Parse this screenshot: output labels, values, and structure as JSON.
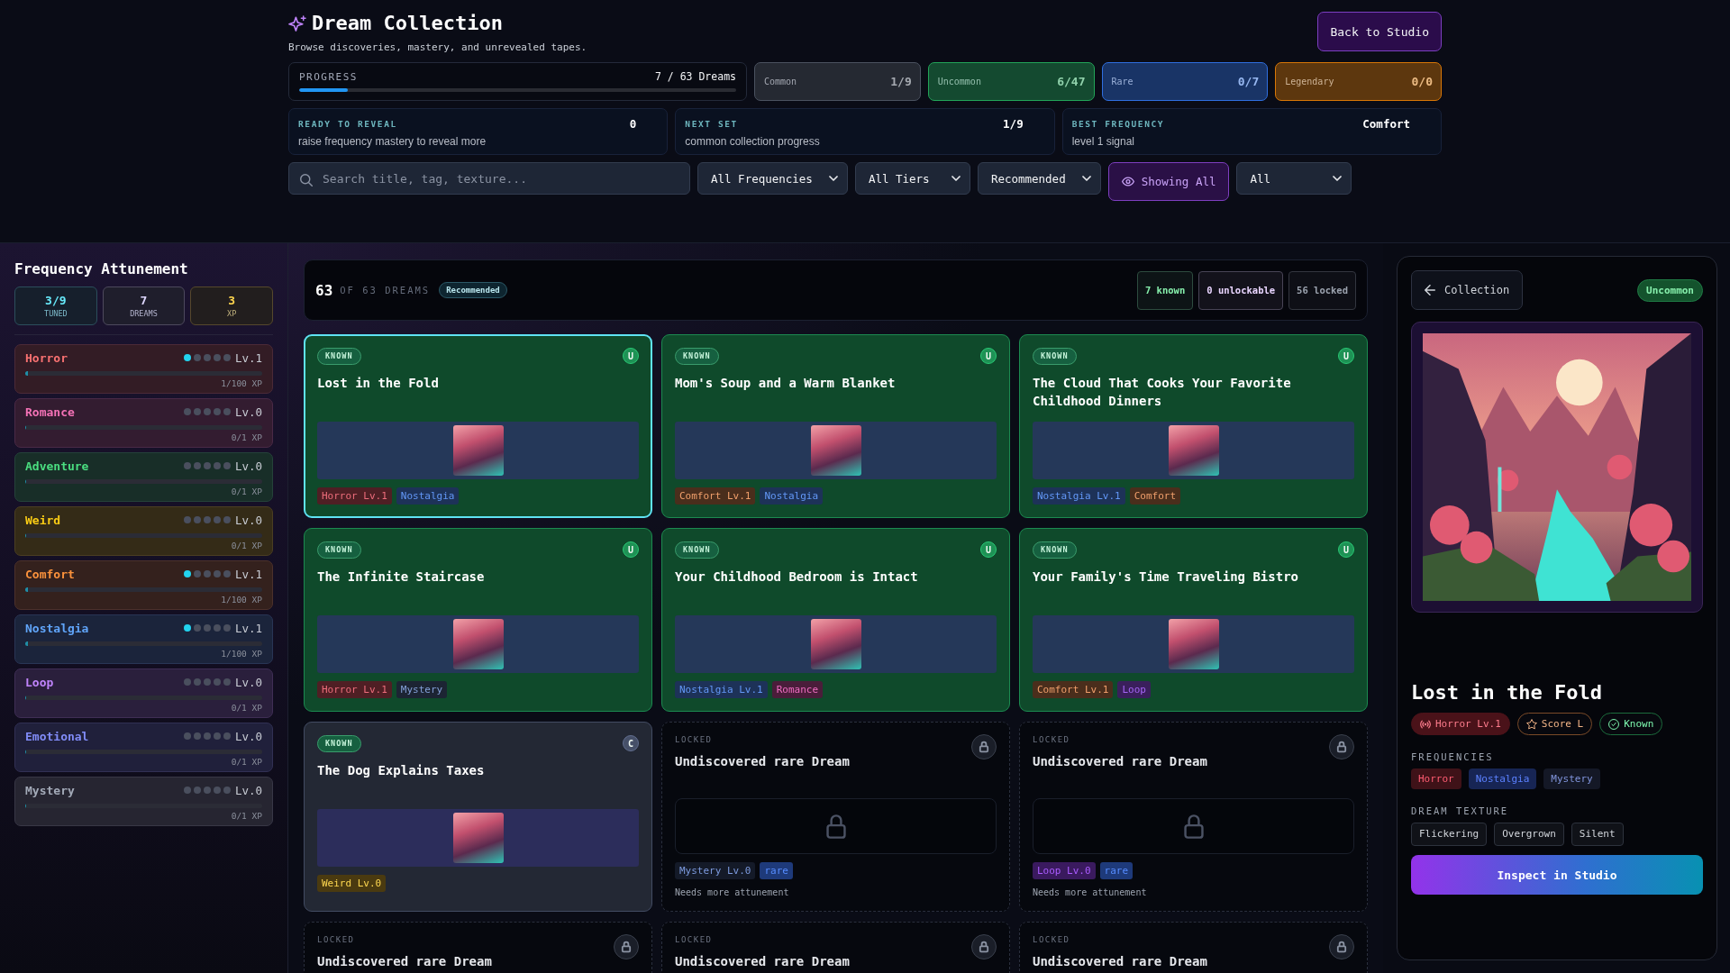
{
  "header": {
    "title": "Dream Collection",
    "subtitle": "Browse discoveries, mastery, and unrevealed tapes.",
    "back_button": "Back to Studio"
  },
  "progress": {
    "label": "PROGRESS",
    "value": "7 / 63 Dreams",
    "level": 0.111
  },
  "tiers": [
    {
      "label": "Common",
      "value": "1/9",
      "color": "#4b5260"
    },
    {
      "label": "Uncommon",
      "value": "6/47",
      "color": "#22a559"
    },
    {
      "label": "Rare",
      "value": "0/7",
      "color": "#2f6fe0"
    },
    {
      "label": "Legendary",
      "value": "0/0",
      "color": "#d97706"
    }
  ],
  "info_cards": [
    {
      "label": "READY TO REVEAL",
      "value": "0",
      "description": "raise frequency mastery to reveal more"
    },
    {
      "label": "NEXT SET",
      "value": "1/9",
      "description": "common collection progress"
    },
    {
      "label": "BEST FREQUENCY",
      "value": "Comfort",
      "description": "level 1 signal"
    }
  ],
  "filters": [
    {
      "kind": "search",
      "placeholder": "Search title, tag, texture..."
    },
    {
      "kind": "select",
      "value": "All Frequencies"
    },
    {
      "kind": "select",
      "value": "All Tiers"
    },
    {
      "kind": "select",
      "value": "Recommended"
    },
    {
      "kind": "toggle",
      "label": "Showing All",
      "on": true
    },
    {
      "kind": "select",
      "value": "All"
    }
  ],
  "sidebar": {
    "title": "Frequency Attunement",
    "stats": [
      {
        "value": "3/9",
        "label": "TUNED",
        "color": "#67e8f9"
      },
      {
        "value": "7",
        "label": "DREAMS",
        "color": "#ddd6fe"
      },
      {
        "value": "3",
        "label": "XP",
        "color": "#fcd34d"
      }
    ],
    "frequencies": [
      {
        "name": "Horror",
        "color": "#f87171",
        "stars": 1,
        "rank": "Lv.1",
        "level": 0.01,
        "xp": "1/100 XP"
      },
      {
        "name": "Romance",
        "color": "#f472b6",
        "stars": 0,
        "rank": "Lv.0",
        "level": 0,
        "xp": "0/1 XP"
      },
      {
        "name": "Adventure",
        "color": "#4ade80",
        "stars": 0,
        "rank": "Lv.0",
        "level": 0,
        "xp": "0/1 XP"
      },
      {
        "name": "Weird",
        "color": "#facc15",
        "stars": 0,
        "rank": "Lv.0",
        "level": 0,
        "xp": "0/1 XP"
      },
      {
        "name": "Comfort",
        "color": "#fb923c",
        "stars": 1,
        "rank": "Lv.1",
        "level": 0.01,
        "xp": "1/100 XP"
      },
      {
        "name": "Nostalgia",
        "color": "#60a5fa",
        "stars": 1,
        "rank": "Lv.1",
        "level": 0.01,
        "xp": "1/100 XP"
      },
      {
        "name": "Loop",
        "color": "#c084fc",
        "stars": 0,
        "rank": "Lv.0",
        "level": 0,
        "xp": "0/1 XP"
      },
      {
        "name": "Emotional",
        "color": "#818cf8",
        "stars": 0,
        "rank": "Lv.0",
        "level": 0,
        "xp": "0/1 XP"
      },
      {
        "name": "Mystery",
        "color": "#a3aab8",
        "stars": 0,
        "rank": "Lv.0",
        "level": 0,
        "xp": "0/1 XP"
      }
    ]
  },
  "summary": {
    "count": "63",
    "total": "OF 63 DREAMS",
    "sort": "Recommended",
    "counts": [
      {
        "label": "7 known",
        "color": "#86efac"
      },
      {
        "label": "0 unlockable",
        "color": "#e9d5ff"
      },
      {
        "label": "56 locked",
        "color": "#9ca3af"
      }
    ]
  },
  "dreams": [
    {
      "kind": "known",
      "status": "KNOWN",
      "tier_badge": "U",
      "color": "#0f4a2b",
      "title": "Lost in the Fold",
      "selected": true,
      "tags": [
        {
          "label": "Horror Lv.1",
          "color": "#4f1f24"
        },
        {
          "label": "Nostalgia",
          "color": "#1d3258"
        }
      ]
    },
    {
      "kind": "known",
      "status": "KNOWN",
      "tier_badge": "U",
      "color": "#0f4a2b",
      "title": "Mom's Soup and a Warm Blanket",
      "selected": false,
      "tags": [
        {
          "label": "Comfort Lv.1",
          "color": "#4a2e1c"
        },
        {
          "label": "Nostalgia",
          "color": "#1d3258"
        }
      ]
    },
    {
      "kind": "known",
      "status": "KNOWN",
      "tier_badge": "U",
      "color": "#0f4a2b",
      "title": "The Cloud That Cooks Your Favorite Childhood Dinners",
      "selected": false,
      "tags": [
        {
          "label": "Nostalgia Lv.1",
          "color": "#1d3258"
        },
        {
          "label": "Comfort",
          "color": "#4a2e1c"
        }
      ]
    },
    {
      "kind": "known",
      "status": "KNOWN",
      "tier_badge": "U",
      "color": "#0f4a2b",
      "title": "The Infinite Staircase",
      "selected": false,
      "tags": [
        {
          "label": "Horror Lv.1",
          "color": "#4f1f24"
        },
        {
          "label": "Mystery",
          "color": "#1c2433"
        }
      ]
    },
    {
      "kind": "known",
      "status": "KNOWN",
      "tier_badge": "U",
      "color": "#0f4a2b",
      "title": "Your Childhood Bedroom is Intact",
      "selected": false,
      "tags": [
        {
          "label": "Nostalgia Lv.1",
          "color": "#1d3258"
        },
        {
          "label": "Romance",
          "color": "#4a1d3a"
        }
      ]
    },
    {
      "kind": "known",
      "status": "KNOWN",
      "tier_badge": "U",
      "color": "#0f4a2b",
      "title": "Your Family's Time Traveling Bistro",
      "selected": false,
      "tags": [
        {
          "label": "Comfort Lv.1",
          "color": "#4a2e1c"
        },
        {
          "label": "Loop",
          "color": "#3a1f5c"
        }
      ]
    },
    {
      "kind": "known",
      "status": "KNOWN",
      "tier_badge": "C",
      "color": "#232834",
      "title": "The Dog Explains Taxes",
      "selected": false,
      "tags": [
        {
          "label": "Weird Lv.0",
          "color": "#4a3a10"
        }
      ]
    },
    {
      "kind": "locked",
      "status": "LOCKED",
      "title": "Undiscovered rare Dream",
      "selected": false,
      "tags": [
        {
          "label": "Mystery Lv.0",
          "color": "#141a28"
        },
        {
          "label": "rare",
          "color": "#1e3a7a"
        }
      ],
      "note": "Needs more attunement"
    },
    {
      "kind": "locked",
      "status": "LOCKED",
      "title": "Undiscovered rare Dream",
      "selected": false,
      "tags": [
        {
          "label": "Loop Lv.0",
          "color": "#3a1a5e"
        },
        {
          "label": "rare",
          "color": "#1e3a7a"
        }
      ],
      "note": "Needs more attunement"
    },
    {
      "kind": "locked",
      "status": "LOCKED",
      "title": "Undiscovered rare Dream",
      "selected": false
    },
    {
      "kind": "locked",
      "status": "LOCKED",
      "title": "Undiscovered rare Dream",
      "selected": false
    },
    {
      "kind": "locked",
      "status": "LOCKED",
      "title": "Undiscovered rare Dream",
      "selected": false
    }
  ],
  "detail": {
    "back_button": "Collection",
    "tier": "Uncommon",
    "title": "Lost in the Fold",
    "badges": [
      {
        "kind": "frequency",
        "label": "Horror Lv.1",
        "color": "#4a1219"
      },
      {
        "kind": "score",
        "label": "Score L",
        "color": "#7a4a28"
      },
      {
        "kind": "status",
        "label": "Known",
        "color": "#1c6b3c"
      }
    ],
    "frequencies_label": "FREQUENCIES",
    "frequencies": [
      {
        "label": "Horror",
        "color": "#3f1218"
      },
      {
        "label": "Nostalgia",
        "color": "#172554"
      },
      {
        "label": "Mystery",
        "color": "#141826"
      }
    ],
    "texture_label": "DREAM TEXTURE",
    "textures": [
      "Flickering",
      "Overgrown",
      "Silent"
    ],
    "inspect_button": "Inspect in Studio"
  }
}
